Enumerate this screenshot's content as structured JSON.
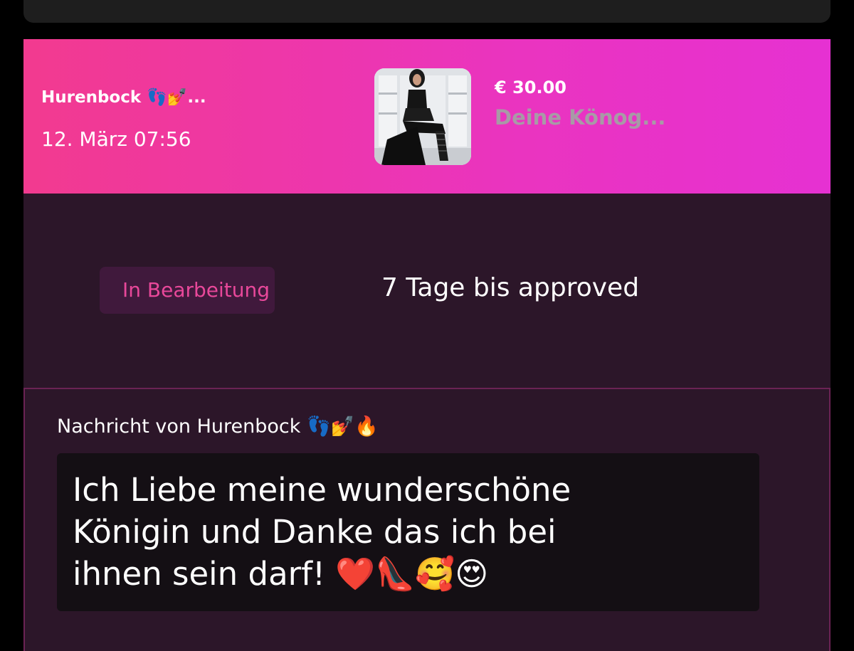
{
  "order": {
    "sender_name": "Hurenbock 👣💅...",
    "date": "12. März 07:56",
    "price": "€ 30.00",
    "product_title": "Deine Könog..."
  },
  "status": {
    "badge_label": "In Bearbeitung",
    "approval_text": "7 Tage bis approved"
  },
  "message": {
    "from_label": "Nachricht von Hurenbock 👣💅🔥",
    "body": "Ich Liebe meine wunderschöne\nKönigin und Danke das ich bei\nihnen sein darf! ❤️👠🥰😍"
  },
  "colors": {
    "header_gradient_start": "#f23a8f",
    "header_gradient_end": "#e631d2",
    "panel_background": "#2c1629",
    "badge_text": "#e8489a",
    "badge_background": "#40193c",
    "message_box": "#140f14"
  }
}
